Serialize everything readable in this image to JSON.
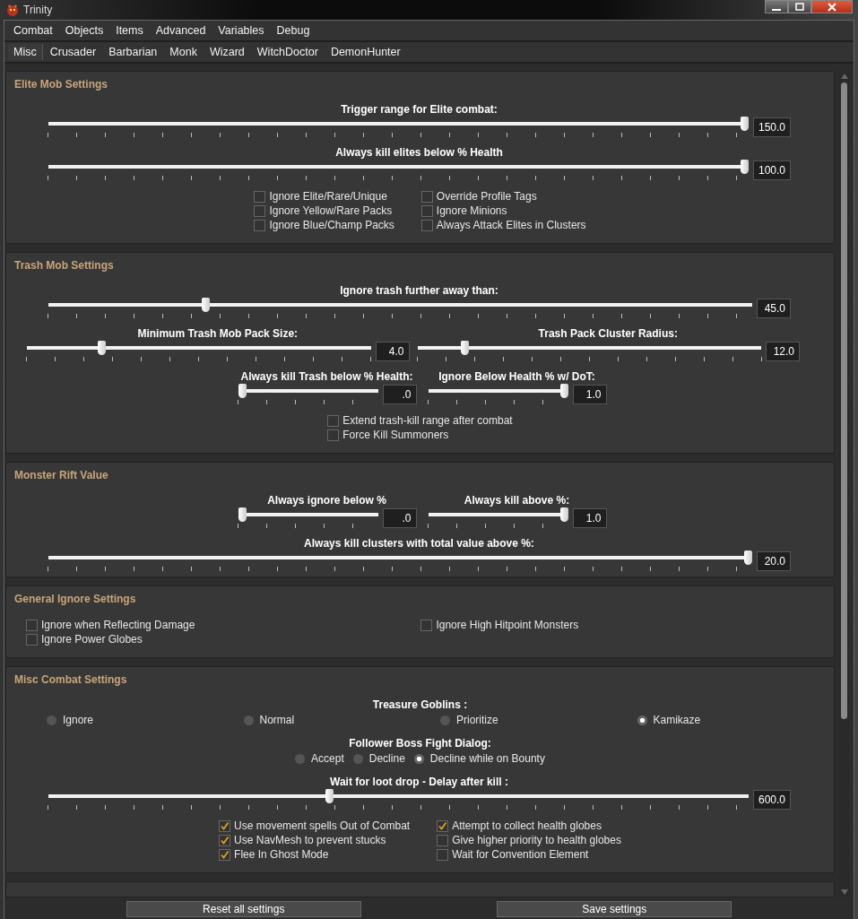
{
  "window": {
    "title": "Trinity"
  },
  "tabs": [
    "Combat",
    "Objects",
    "Items",
    "Advanced",
    "Variables",
    "Debug"
  ],
  "subtabs": [
    {
      "label": "Misc",
      "selected": true
    },
    {
      "label": "Crusader",
      "selected": false
    },
    {
      "label": "Barbarian",
      "selected": false
    },
    {
      "label": "Monk",
      "selected": false
    },
    {
      "label": "Wizard",
      "selected": false
    },
    {
      "label": "WitchDoctor",
      "selected": false
    },
    {
      "label": "DemonHunter",
      "selected": false
    }
  ],
  "sections": [
    {
      "title": "Elite Mob Settings",
      "items": [
        {
          "kind": "slider",
          "label": "Trigger range for Elite combat:",
          "reading": "150.0",
          "level": 1.0
        },
        {
          "kind": "slider",
          "label": "Always kill elites below % Health",
          "reading": "100.0",
          "level": 1.0
        },
        {
          "kind": "checks",
          "columns": [
            [
              {
                "label": "Ignore Elite/Rare/Unique",
                "checked": false
              },
              {
                "label": "Ignore Yellow/Rare Packs",
                "checked": false
              },
              {
                "label": "Ignore Blue/Champ Packs",
                "checked": false
              }
            ],
            [
              {
                "label": "Override Profile Tags",
                "checked": false
              },
              {
                "label": "Ignore Minions",
                "checked": false
              },
              {
                "label": "Always Attack Elites in Clusters",
                "checked": false
              }
            ]
          ]
        }
      ]
    },
    {
      "title": "Trash Mob Settings",
      "items": [
        {
          "kind": "slider",
          "label": "Ignore trash further away than:",
          "reading": "45.0",
          "level": 0.22
        },
        {
          "kind": "pair",
          "sliders": [
            {
              "label": "Minimum Trash Mob Pack Size:",
              "reading": "4.0",
              "level": 0.21
            },
            {
              "label": "Trash Pack Cluster Radius:",
              "reading": "12.0",
              "level": 0.13
            }
          ]
        },
        {
          "kind": "compact_pair",
          "sliders": [
            {
              "label": "Always kill Trash below % Health:",
              "reading": ".0",
              "level": 0
            },
            {
              "label": "Ignore Below Health % w/ DoT:",
              "reading": "1.0",
              "level": 1.0
            }
          ]
        },
        {
          "kind": "checks",
          "columns": [
            [
              {
                "label": "Extend trash-kill range after combat",
                "checked": false
              },
              {
                "label": "Force Kill Summoners",
                "checked": false
              }
            ]
          ]
        }
      ]
    },
    {
      "title": "Monster Rift Value",
      "items": [
        {
          "kind": "compact_pair",
          "sliders": [
            {
              "label": "Always ignore below %",
              "reading": ".0",
              "level": 0
            },
            {
              "label": "Always kill above %:",
              "reading": "1.0",
              "level": 1.0
            }
          ]
        },
        {
          "kind": "slider",
          "label": "Always kill clusters with total value above %:",
          "reading": "20.0",
          "level": 1.0
        }
      ]
    },
    {
      "title": "General Ignore Settings",
      "items": [
        {
          "kind": "spread_checks",
          "columns": [
            [
              {
                "label": "Ignore when Reflecting Damage",
                "checked": false
              },
              {
                "label": "Ignore Power Globes",
                "checked": false
              }
            ],
            [
              {
                "label": "Ignore High Hitpoint Monsters",
                "checked": false
              }
            ]
          ]
        }
      ]
    },
    {
      "title": "Misc Combat Settings",
      "items": [
        {
          "kind": "radio",
          "label": "Treasure Goblins :",
          "options": [
            {
              "label": "Ignore",
              "selected": false
            },
            {
              "label": "Normal",
              "selected": false
            },
            {
              "label": "Prioritize",
              "selected": false
            },
            {
              "label": "Kamikaze",
              "selected": true
            }
          ]
        },
        {
          "kind": "inline_radio",
          "label": "Follower Boss Fight Dialog:",
          "options": [
            {
              "label": "Accept",
              "selected": false
            },
            {
              "label": "Decline",
              "selected": false
            },
            {
              "label": "Decline while on Bounty",
              "selected": true
            }
          ]
        },
        {
          "kind": "slider",
          "label": "Wait for loot drop - Delay after kill :",
          "reading": "600.0",
          "level": 0.4
        },
        {
          "kind": "checks",
          "columns": [
            [
              {
                "label": "Use movement spells Out of Combat",
                "checked": true
              },
              {
                "label": "Use NavMesh to prevent stucks",
                "checked": true
              },
              {
                "label": "Flee In Ghost Mode",
                "checked": true
              }
            ],
            [
              {
                "label": "Attempt to collect health globes",
                "checked": true
              },
              {
                "label": "Give higher priority to health globes",
                "checked": false
              },
              {
                "label": "Wait for Convention Element",
                "checked": false
              }
            ]
          ]
        }
      ]
    }
  ],
  "buttons": [
    "Reset all settings",
    "Save settings"
  ]
}
